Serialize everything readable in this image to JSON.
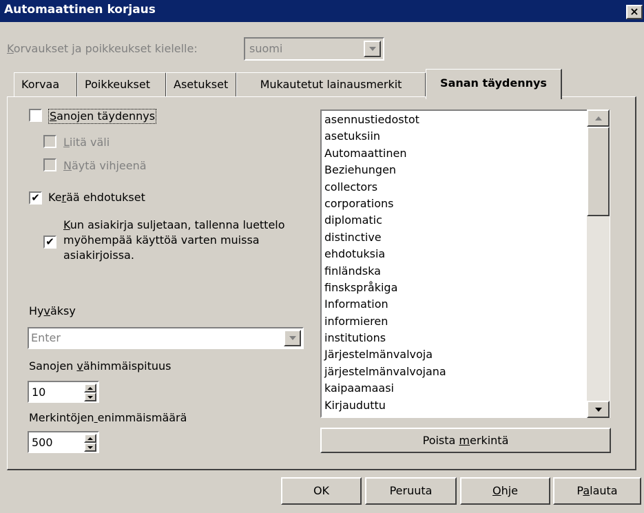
{
  "window": {
    "title": "Automaattinen korjaus",
    "close": "×"
  },
  "language": {
    "label": "Korvaukset ja poikkeukset kielelle:",
    "value": "suomi"
  },
  "tabs": [
    {
      "label": "Korvaa"
    },
    {
      "label": "Poikkeukset"
    },
    {
      "label": "Asetukset"
    },
    {
      "label": "Mukautetut lainausmerkit"
    },
    {
      "label": "Sanan täydennys"
    }
  ],
  "options": {
    "word_completion": {
      "label": "Sanojen täydennys",
      "checked": false
    },
    "append_space": {
      "label": "Liitä väli",
      "checked": false
    },
    "show_as_tip": {
      "label": "Näytä vihjeenä",
      "checked": false
    },
    "collect_suggestions": {
      "label": "Kerää ehdotukset",
      "checked": true,
      "mark": "✔"
    },
    "save_on_close": {
      "label_lines": [
        "Kun asiakirja suljetaan, tallenna luettelo",
        "myöhempää käyttöä varten muissa",
        "asiakirjoissa."
      ],
      "checked": true,
      "mark": "✔"
    }
  },
  "accept": {
    "label": "Hyväksy",
    "value": "Enter"
  },
  "min_length": {
    "label": "Sanojen vähimmäispituus",
    "value": "10"
  },
  "max_entries": {
    "label": "Merkintöjen enimmäismäärä",
    "value": "500"
  },
  "word_list": [
    "asennustiedostot",
    "asetuksiin",
    "Automaattinen",
    "Beziehungen",
    "collectors",
    "corporations",
    "diplomatic",
    "distinctive",
    "ehdotuksia",
    "finländska",
    "finskspråkiga",
    "Information",
    "informieren",
    "institutions",
    "Järjestelmänvalvoja",
    "järjestelmänvalvojana",
    "kaipaamaasi",
    "Kirjauduttu"
  ],
  "buttons": {
    "remove_entry": "Poista merkintä",
    "ok": "OK",
    "cancel": "Peruuta",
    "help": "Ohje",
    "restore": "Palauta"
  }
}
